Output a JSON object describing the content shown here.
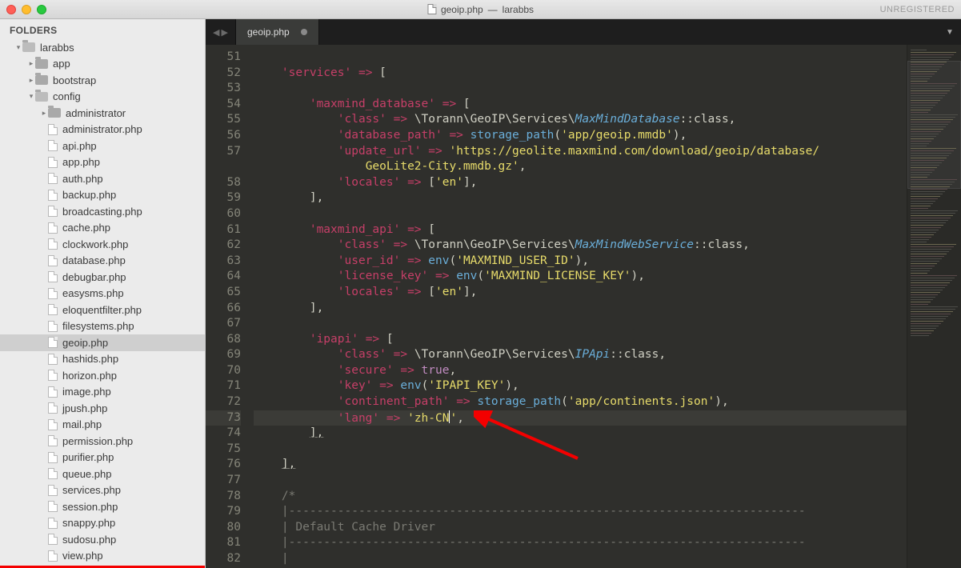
{
  "window": {
    "title_file": "geoip.php",
    "title_project": "larabbs",
    "unregistered": "UNREGISTERED"
  },
  "sidebar": {
    "header": "FOLDERS",
    "tree": [
      {
        "depth": 0,
        "type": "folder-open",
        "arrow": "▾",
        "label": "larabbs"
      },
      {
        "depth": 1,
        "type": "folder",
        "arrow": "▸",
        "label": "app"
      },
      {
        "depth": 1,
        "type": "folder",
        "arrow": "▸",
        "label": "bootstrap"
      },
      {
        "depth": 1,
        "type": "folder-open",
        "arrow": "▾",
        "label": "config"
      },
      {
        "depth": 2,
        "type": "folder",
        "arrow": "▸",
        "label": "administrator"
      },
      {
        "depth": 2,
        "type": "file",
        "label": "administrator.php"
      },
      {
        "depth": 2,
        "type": "file",
        "label": "api.php"
      },
      {
        "depth": 2,
        "type": "file",
        "label": "app.php"
      },
      {
        "depth": 2,
        "type": "file",
        "label": "auth.php"
      },
      {
        "depth": 2,
        "type": "file",
        "label": "backup.php"
      },
      {
        "depth": 2,
        "type": "file",
        "label": "broadcasting.php"
      },
      {
        "depth": 2,
        "type": "file",
        "label": "cache.php"
      },
      {
        "depth": 2,
        "type": "file",
        "label": "clockwork.php"
      },
      {
        "depth": 2,
        "type": "file",
        "label": "database.php"
      },
      {
        "depth": 2,
        "type": "file",
        "label": "debugbar.php"
      },
      {
        "depth": 2,
        "type": "file",
        "label": "easysms.php"
      },
      {
        "depth": 2,
        "type": "file",
        "label": "eloquentfilter.php"
      },
      {
        "depth": 2,
        "type": "file",
        "label": "filesystems.php"
      },
      {
        "depth": 2,
        "type": "file",
        "label": "geoip.php",
        "selected": true
      },
      {
        "depth": 2,
        "type": "file",
        "label": "hashids.php"
      },
      {
        "depth": 2,
        "type": "file",
        "label": "horizon.php"
      },
      {
        "depth": 2,
        "type": "file",
        "label": "image.php"
      },
      {
        "depth": 2,
        "type": "file",
        "label": "jpush.php"
      },
      {
        "depth": 2,
        "type": "file",
        "label": "mail.php"
      },
      {
        "depth": 2,
        "type": "file",
        "label": "permission.php"
      },
      {
        "depth": 2,
        "type": "file",
        "label": "purifier.php"
      },
      {
        "depth": 2,
        "type": "file",
        "label": "queue.php"
      },
      {
        "depth": 2,
        "type": "file",
        "label": "services.php"
      },
      {
        "depth": 2,
        "type": "file",
        "label": "session.php"
      },
      {
        "depth": 2,
        "type": "file",
        "label": "snappy.php"
      },
      {
        "depth": 2,
        "type": "file",
        "label": "sudosu.php"
      },
      {
        "depth": 2,
        "type": "file",
        "label": "view.php"
      }
    ]
  },
  "tabbar": {
    "nav_back": "◀",
    "nav_fwd": "▶",
    "active_tab": "geoip.php",
    "dropdown": "▼"
  },
  "code": {
    "first_line_no": 51,
    "lines": [
      {
        "n": 51,
        "html": ""
      },
      {
        "n": 52,
        "html": "    <span class='tk-strq'>'services'</span> <span class='tk-op'>=&gt;</span> <span class='tk-punc'>[</span>"
      },
      {
        "n": 53,
        "html": ""
      },
      {
        "n": 54,
        "html": "        <span class='tk-strq'>'maxmind_database'</span> <span class='tk-op'>=&gt;</span> <span class='tk-punc'>[</span>"
      },
      {
        "n": 55,
        "html": "            <span class='tk-strq'>'class'</span> <span class='tk-op'>=&gt;</span> <span class='tk-classns'>\\Torann\\GeoIP\\Services\\</span><span class='tk-id'>MaxMindDatabase</span><span class='tk-punc'>::class,</span>"
      },
      {
        "n": 56,
        "html": "            <span class='tk-strq'>'database_path'</span> <span class='tk-op'>=&gt;</span> <span class='tk-fn'>storage_path</span><span class='tk-punc'>(</span><span class='tk-str'>'app/geoip.mmdb'</span><span class='tk-punc'>),</span>"
      },
      {
        "n": 57,
        "html": "            <span class='tk-strq'>'update_url'</span> <span class='tk-op'>=&gt;</span> <span class='tk-str'>'https://geolite.maxmind.com/download/geoip/database/</span>"
      },
      {
        "n": "",
        "html": "                <span class='tk-str'>GeoLite2-City.mmdb.gz'</span><span class='tk-punc'>,</span>",
        "wrap": true
      },
      {
        "n": 58,
        "html": "            <span class='tk-strq'>'locales'</span> <span class='tk-op'>=&gt;</span> <span class='tk-punc'>[</span><span class='tk-str'>'en'</span><span class='tk-punc'>],</span>"
      },
      {
        "n": 59,
        "html": "        <span class='tk-punc'>],</span>"
      },
      {
        "n": 60,
        "html": ""
      },
      {
        "n": 61,
        "html": "        <span class='tk-strq'>'maxmind_api'</span> <span class='tk-op'>=&gt;</span> <span class='tk-punc'>[</span>"
      },
      {
        "n": 62,
        "html": "            <span class='tk-strq'>'class'</span> <span class='tk-op'>=&gt;</span> <span class='tk-classns'>\\Torann\\GeoIP\\Services\\</span><span class='tk-id'>MaxMindWebService</span><span class='tk-punc'>::class,</span>"
      },
      {
        "n": 63,
        "html": "            <span class='tk-strq'>'user_id'</span> <span class='tk-op'>=&gt;</span> <span class='tk-fn'>env</span><span class='tk-punc'>(</span><span class='tk-str'>'MAXMIND_USER_ID'</span><span class='tk-punc'>),</span>"
      },
      {
        "n": 64,
        "html": "            <span class='tk-strq'>'license_key'</span> <span class='tk-op'>=&gt;</span> <span class='tk-fn'>env</span><span class='tk-punc'>(</span><span class='tk-str'>'MAXMIND_LICENSE_KEY'</span><span class='tk-punc'>),</span>"
      },
      {
        "n": 65,
        "html": "            <span class='tk-strq'>'locales'</span> <span class='tk-op'>=&gt;</span> <span class='tk-punc'>[</span><span class='tk-str'>'en'</span><span class='tk-punc'>],</span>"
      },
      {
        "n": 66,
        "html": "        <span class='tk-punc'>],</span>"
      },
      {
        "n": 67,
        "html": ""
      },
      {
        "n": 68,
        "html": "        <span class='tk-strq'>'ipapi'</span> <span class='tk-op'>=&gt;</span> <span class='tk-punc'>[</span>"
      },
      {
        "n": 69,
        "html": "            <span class='tk-strq'>'class'</span> <span class='tk-op'>=&gt;</span> <span class='tk-classns'>\\Torann\\GeoIP\\Services\\</span><span class='tk-id'>IPApi</span><span class='tk-punc'>::class,</span>"
      },
      {
        "n": 70,
        "html": "            <span class='tk-strq'>'secure'</span> <span class='tk-op'>=&gt;</span> <span class='tk-kw'>true</span><span class='tk-punc'>,</span>"
      },
      {
        "n": 71,
        "html": "            <span class='tk-strq'>'key'</span> <span class='tk-op'>=&gt;</span> <span class='tk-fn'>env</span><span class='tk-punc'>(</span><span class='tk-str'>'IPAPI_KEY'</span><span class='tk-punc'>),</span>"
      },
      {
        "n": 72,
        "html": "            <span class='tk-strq'>'continent_path'</span> <span class='tk-op'>=&gt;</span> <span class='tk-fn'>storage_path</span><span class='tk-punc'>(</span><span class='tk-str'>'app/continents.json'</span><span class='tk-punc'>),</span>"
      },
      {
        "n": 73,
        "html": "            <span class='tk-strq'>'lang'</span> <span class='tk-op'>=&gt;</span> <span class='tk-str'>'zh-CN</span><span class='cursor-caret'></span><span class='tk-str'>'</span><span class='tk-punc'>,</span>",
        "hl": true
      },
      {
        "n": 74,
        "html": "        <span class='tk-punc underline'>],</span>"
      },
      {
        "n": 75,
        "html": ""
      },
      {
        "n": 76,
        "html": "    <span class='tk-punc underline'>],</span>"
      },
      {
        "n": 77,
        "html": ""
      },
      {
        "n": 78,
        "html": "    <span class='tk-cmt'>/*</span>"
      },
      {
        "n": 79,
        "html": "    <span class='tk-cmt'>|--------------------------------------------------------------------------</span>"
      },
      {
        "n": 80,
        "html": "    <span class='tk-cmt'>| Default Cache Driver</span>"
      },
      {
        "n": 81,
        "html": "    <span class='tk-cmt'>|--------------------------------------------------------------------------</span>"
      },
      {
        "n": 82,
        "html": "    <span class='tk-cmt'>|</span>"
      }
    ]
  }
}
